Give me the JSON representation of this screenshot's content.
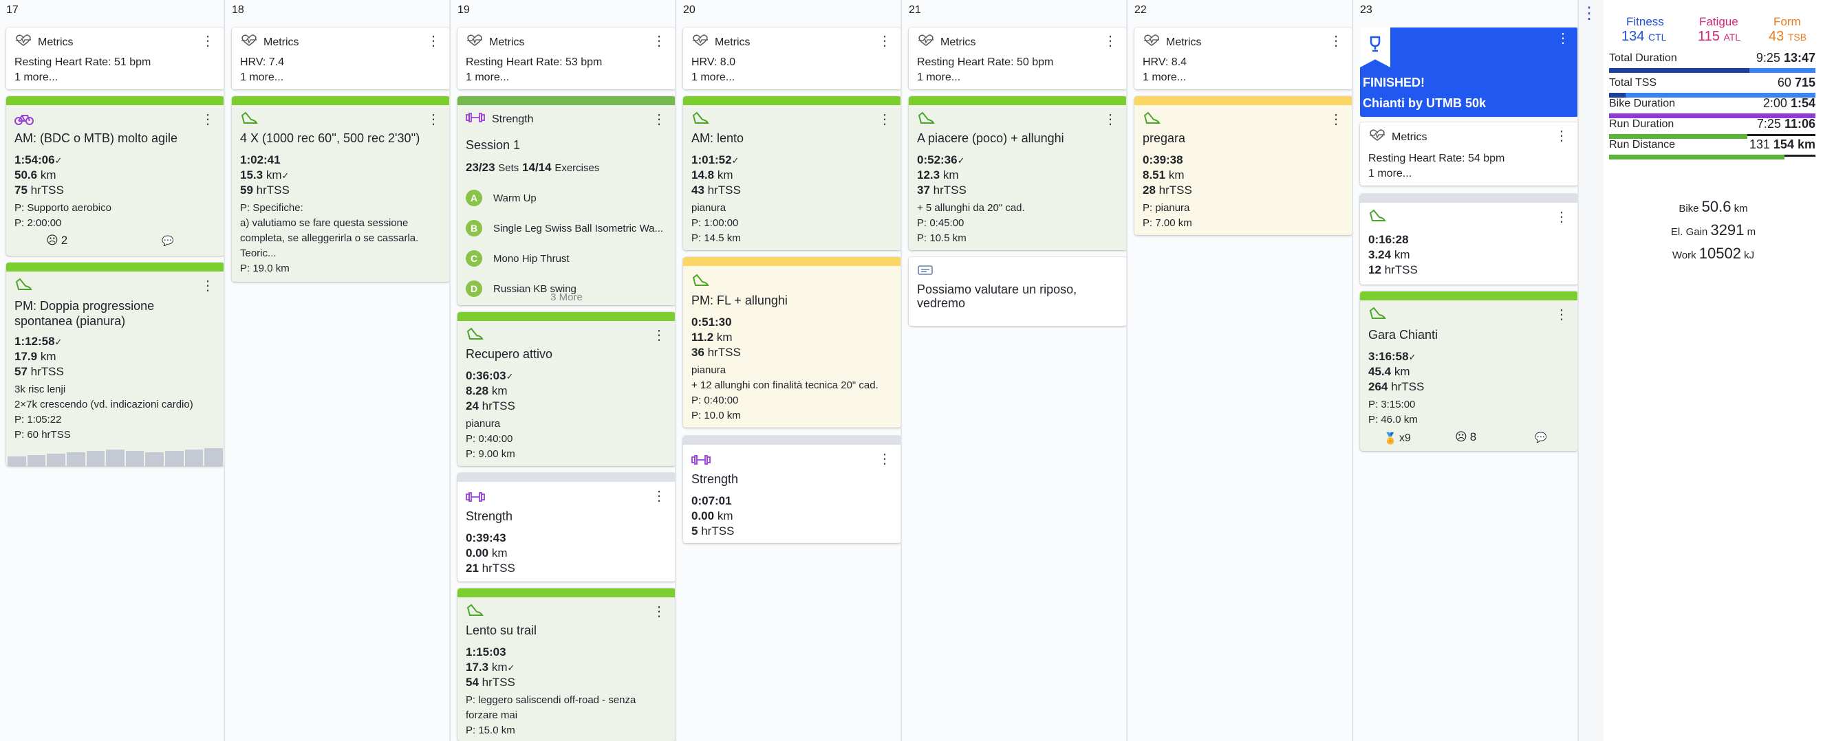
{
  "days": [
    {
      "num": "17"
    },
    {
      "num": "18"
    },
    {
      "num": "19"
    },
    {
      "num": "20"
    },
    {
      "num": "21"
    },
    {
      "num": "22"
    },
    {
      "num": "23"
    }
  ],
  "metrics": [
    {
      "head": "Metrics",
      "line": "Resting Heart Rate: 51 bpm",
      "more": "1 more..."
    },
    {
      "head": "Metrics",
      "line": "HRV: 7.4",
      "more": "1 more..."
    },
    {
      "head": "Metrics",
      "line": "Resting Heart Rate: 53 bpm",
      "more": "1 more..."
    },
    {
      "head": "Metrics",
      "line": "HRV: 8.0",
      "more": "1 more..."
    },
    {
      "head": "Metrics",
      "line": "Resting Heart Rate: 50 bpm",
      "more": "1 more..."
    },
    {
      "head": "Metrics",
      "line": "HRV: 8.4",
      "more": "1 more..."
    },
    {
      "head": "Metrics",
      "line": "Resting Heart Rate: 54 bpm",
      "more": "1 more..."
    }
  ],
  "d17": {
    "a1": {
      "title": "AM: (BDC o MTB) molto agile",
      "dur": "1:54:06",
      "dist": "50.6",
      "dist_u": "km",
      "tss": "75",
      "tss_u": "hrTSS",
      "p1": "P: Supporto aerobico",
      "p2": "P: 2:00:00",
      "smile": "2"
    },
    "a2": {
      "title1": "PM: Doppia progressione",
      "title2": "spontanea (pianura)",
      "dur": "1:12:58",
      "dist": "17.9",
      "dist_u": "km",
      "tss": "57",
      "tss_u": "hrTSS",
      "n1": "3k risc lenji",
      "n2": "2×7k crescendo (vd. indicazioni cardio)",
      "n3": "P: 1:05:22",
      "n4": "P: 60 hrTSS"
    }
  },
  "d18": {
    "a1": {
      "title": "4 X (1000 rec 60'', 500 rec 2'30'')",
      "dur": "1:02:41",
      "dist": "15.3",
      "dist_u": "km",
      "tss": "59",
      "tss_u": "hrTSS",
      "n1": "P: Specifiche:",
      "n2": "a) valutiamo se fare questa sessione",
      "n3": "completa, se alleggerirla o se cassarla.",
      "n4": "Teoric...",
      "n5": "P: 19.0 km"
    }
  },
  "d19": {
    "s1": {
      "head": "Strength",
      "title": "Session 1",
      "sets": "23/23",
      "sets_l": "Sets",
      "ex": "14/14",
      "ex_l": "Exercises",
      "items": [
        {
          "k": "A",
          "n": "Warm Up"
        },
        {
          "k": "B",
          "n": "Single Leg Swiss Ball Isometric Wa..."
        },
        {
          "k": "C",
          "n": "Mono Hip Thrust"
        },
        {
          "k": "D",
          "n": "Russian KB swing"
        }
      ],
      "more": "3 More"
    },
    "a2": {
      "title": "Recupero attivo",
      "dur": "0:36:03",
      "dist": "8.28",
      "dist_u": "km",
      "tss": "24",
      "tss_u": "hrTSS",
      "n1": "pianura",
      "n2": "P: 0:40:00",
      "n3": "P: 9.00 km"
    },
    "a3": {
      "title": "Strength",
      "dur": "0:39:43",
      "dist": "0.00",
      "dist_u": "km",
      "tss": "21",
      "tss_u": "hrTSS"
    },
    "a4": {
      "title": "Lento su trail",
      "dur": "1:15:03",
      "dist": "17.3",
      "dist_u": "km",
      "tss": "54",
      "tss_u": "hrTSS",
      "n1": "P: leggero saliscendi off-road - senza",
      "n2": "forzare mai",
      "n3": "P: 15.0 km"
    }
  },
  "d20": {
    "a1": {
      "title": "AM: lento",
      "dur": "1:01:52",
      "dist": "14.8",
      "dist_u": "km",
      "tss": "43",
      "tss_u": "hrTSS",
      "n1": "pianura",
      "n2": "P: 1:00:00",
      "n3": "P: 14.5 km"
    },
    "a2": {
      "title": "PM: FL + allunghi",
      "dur": "0:51:30",
      "dist": "11.2",
      "dist_u": "km",
      "tss": "36",
      "tss_u": "hrTSS",
      "n1": "pianura",
      "n2": "+ 12 allunghi con finalità tecnica 20\" cad.",
      "n3": "P: 0:40:00",
      "n4": "P: 10.0 km"
    },
    "a3": {
      "title": "Strength",
      "dur": "0:07:01",
      "dist": "0.00",
      "dist_u": "km",
      "tss": "5",
      "tss_u": "hrTSS"
    }
  },
  "d21": {
    "a1": {
      "title": "A piacere (poco) + allunghi",
      "dur": "0:52:36",
      "dist": "12.3",
      "dist_u": "km",
      "tss": "37",
      "tss_u": "hrTSS",
      "n1": "+ 5 allunghi da 20\" cad.",
      "n2": "P: 0:45:00",
      "n3": "P: 10.5 km"
    },
    "a2": {
      "title1": "Possiamo valutare un riposo,",
      "title2": "vedremo"
    }
  },
  "d22": {
    "a1": {
      "title": "pregara",
      "dur": "0:39:38",
      "dist": "8.51",
      "dist_u": "km",
      "tss": "28",
      "tss_u": "hrTSS",
      "n1": "P: pianura",
      "n2": "P: 7.00 km"
    }
  },
  "d23": {
    "fin": {
      "l1": "FINISHED!",
      "l2": "Chianti by UTMB 50k"
    },
    "a1": {
      "dur": "0:16:28",
      "dist": "3.24",
      "dist_u": "km",
      "tss": "12",
      "tss_u": "hrTSS"
    },
    "a2": {
      "title": "Gara Chianti",
      "dur": "3:16:58",
      "dist": "45.4",
      "dist_u": "km",
      "tss": "264",
      "tss_u": "hrTSS",
      "n1": "P: 3:15:00",
      "n2": "P: 46.0 km",
      "medal": "x9",
      "smile": "8"
    }
  },
  "summary": {
    "fitness_l": "Fitness",
    "fitness_v": "134",
    "fitness_u": "CTL",
    "fatigue_l": "Fatigue",
    "fatigue_v": "115",
    "fatigue_u": "ATL",
    "form_l": "Form",
    "form_v": "43",
    "form_u": "TSB",
    "totals": [
      {
        "l": "Total Duration",
        "a": "9:25",
        "b": "13:47",
        "pct": 0.68,
        "color": "#1e3f9a"
      },
      {
        "l": "Total TSS",
        "a": "60",
        "b": "715",
        "pct": 0.08,
        "color": "#1e3f9a"
      },
      {
        "l": "Bike Duration",
        "a": "2:00",
        "b": "1:54",
        "pct": 1.0,
        "color": "#8e3bd6"
      },
      {
        "l": "Run Duration",
        "a": "7:25",
        "b": "11:06",
        "pct": 0.67,
        "color": "#5ab43a"
      },
      {
        "l": "Run Distance",
        "a": "131",
        "b": "154",
        "b_u": "km",
        "pct": 0.85,
        "color": "#5ab43a"
      }
    ],
    "bike_l": "Bike",
    "bike_v": "50.6",
    "bike_u": "km",
    "gain_l": "El. Gain",
    "gain_v": "3291",
    "gain_u": "m",
    "work_l": "Work",
    "work_v": "10502",
    "work_u": "kJ"
  },
  "colors": {
    "green": "#7ccd2e",
    "yellow": "#fbd665",
    "blue": "#2058f0",
    "fitness": "#1e50d6",
    "fatigue": "#d6267a",
    "form": "#ee7a1a"
  }
}
